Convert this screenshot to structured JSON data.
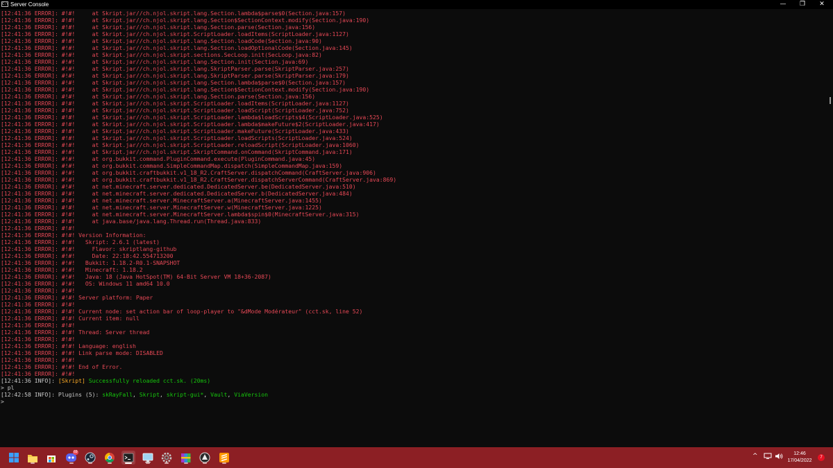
{
  "window": {
    "title": "Server Console",
    "icon_label": "C:\\",
    "minimize_glyph": "—",
    "maximize_glyph": "❐",
    "close_glyph": "✕"
  },
  "console": {
    "lines": [
      {
        "t": "[12:41:36 ERROR]: #!#!     at Skript.jar//ch.njol.skript.lang.Section.lambda$parse$0(Section.java:157)",
        "c": "err"
      },
      {
        "t": "[12:41:36 ERROR]: #!#!     at Skript.jar//ch.njol.skript.lang.Section$SectionContext.modify(Section.java:190)",
        "c": "err"
      },
      {
        "t": "[12:41:36 ERROR]: #!#!     at Skript.jar//ch.njol.skript.lang.Section.parse(Section.java:156)",
        "c": "err"
      },
      {
        "t": "[12:41:36 ERROR]: #!#!     at Skript.jar//ch.njol.skript.ScriptLoader.loadItems(ScriptLoader.java:1127)",
        "c": "err"
      },
      {
        "t": "[12:41:36 ERROR]: #!#!     at Skript.jar//ch.njol.skript.lang.Section.loadCode(Section.java:90)",
        "c": "err"
      },
      {
        "t": "[12:41:36 ERROR]: #!#!     at Skript.jar//ch.njol.skript.lang.Section.loadOptionalCode(Section.java:145)",
        "c": "err"
      },
      {
        "t": "[12:41:36 ERROR]: #!#!     at Skript.jar//ch.njol.skript.sections.SecLoop.init(SecLoop.java:82)",
        "c": "err"
      },
      {
        "t": "[12:41:36 ERROR]: #!#!     at Skript.jar//ch.njol.skript.lang.Section.init(Section.java:69)",
        "c": "err"
      },
      {
        "t": "[12:41:36 ERROR]: #!#!     at Skript.jar//ch.njol.skript.lang.SkriptParser.parse(SkriptParser.java:257)",
        "c": "err"
      },
      {
        "t": "[12:41:36 ERROR]: #!#!     at Skript.jar//ch.njol.skript.lang.SkriptParser.parse(SkriptParser.java:179)",
        "c": "err"
      },
      {
        "t": "[12:41:36 ERROR]: #!#!     at Skript.jar//ch.njol.skript.lang.Section.lambda$parse$0(Section.java:157)",
        "c": "err"
      },
      {
        "t": "[12:41:36 ERROR]: #!#!     at Skript.jar//ch.njol.skript.lang.Section$SectionContext.modify(Section.java:190)",
        "c": "err"
      },
      {
        "t": "[12:41:36 ERROR]: #!#!     at Skript.jar//ch.njol.skript.lang.Section.parse(Section.java:156)",
        "c": "err"
      },
      {
        "t": "[12:41:36 ERROR]: #!#!     at Skript.jar//ch.njol.skript.ScriptLoader.loadItems(ScriptLoader.java:1127)",
        "c": "err"
      },
      {
        "t": "[12:41:36 ERROR]: #!#!     at Skript.jar//ch.njol.skript.ScriptLoader.loadScript(ScriptLoader.java:752)",
        "c": "err"
      },
      {
        "t": "[12:41:36 ERROR]: #!#!     at Skript.jar//ch.njol.skript.ScriptLoader.lambda$loadScripts$4(ScriptLoader.java:525)",
        "c": "err"
      },
      {
        "t": "[12:41:36 ERROR]: #!#!     at Skript.jar//ch.njol.skript.ScriptLoader.lambda$makeFuture$2(ScriptLoader.java:417)",
        "c": "err"
      },
      {
        "t": "[12:41:36 ERROR]: #!#!     at Skript.jar//ch.njol.skript.ScriptLoader.makeFuture(ScriptLoader.java:433)",
        "c": "err"
      },
      {
        "t": "[12:41:36 ERROR]: #!#!     at Skript.jar//ch.njol.skript.ScriptLoader.loadScripts(ScriptLoader.java:524)",
        "c": "err"
      },
      {
        "t": "[12:41:36 ERROR]: #!#!     at Skript.jar//ch.njol.skript.ScriptLoader.reloadScript(ScriptLoader.java:1060)",
        "c": "err"
      },
      {
        "t": "[12:41:36 ERROR]: #!#!     at Skript.jar//ch.njol.skript.SkriptCommand.onCommand(SkriptCommand.java:171)",
        "c": "err"
      },
      {
        "t": "[12:41:36 ERROR]: #!#!     at org.bukkit.command.PluginCommand.execute(PluginCommand.java:45)",
        "c": "err"
      },
      {
        "t": "[12:41:36 ERROR]: #!#!     at org.bukkit.command.SimpleCommandMap.dispatch(SimpleCommandMap.java:159)",
        "c": "err"
      },
      {
        "t": "[12:41:36 ERROR]: #!#!     at org.bukkit.craftbukkit.v1_18_R2.CraftServer.dispatchCommand(CraftServer.java:906)",
        "c": "err"
      },
      {
        "t": "[12:41:36 ERROR]: #!#!     at org.bukkit.craftbukkit.v1_18_R2.CraftServer.dispatchServerCommand(CraftServer.java:869)",
        "c": "err"
      },
      {
        "t": "[12:41:36 ERROR]: #!#!     at net.minecraft.server.dedicated.DedicatedServer.be(DedicatedServer.java:510)",
        "c": "err"
      },
      {
        "t": "[12:41:36 ERROR]: #!#!     at net.minecraft.server.dedicated.DedicatedServer.b(DedicatedServer.java:484)",
        "c": "err"
      },
      {
        "t": "[12:41:36 ERROR]: #!#!     at net.minecraft.server.MinecraftServer.a(MinecraftServer.java:1455)",
        "c": "err"
      },
      {
        "t": "[12:41:36 ERROR]: #!#!     at net.minecraft.server.MinecraftServer.w(MinecraftServer.java:1225)",
        "c": "err"
      },
      {
        "t": "[12:41:36 ERROR]: #!#!     at net.minecraft.server.MinecraftServer.lambda$spin$0(MinecraftServer.java:315)",
        "c": "err"
      },
      {
        "t": "[12:41:36 ERROR]: #!#!     at java.base/java.lang.Thread.run(Thread.java:833)",
        "c": "err"
      },
      {
        "t": "[12:41:36 ERROR]: #!#!",
        "c": "err"
      },
      {
        "t": "[12:41:36 ERROR]: #!#! Version Information:",
        "c": "err"
      },
      {
        "t": "[12:41:36 ERROR]: #!#!   Skript: 2.6.1 (latest)",
        "c": "err"
      },
      {
        "t": "[12:41:36 ERROR]: #!#!     Flavor: skriptlang-github",
        "c": "err"
      },
      {
        "t": "[12:41:36 ERROR]: #!#!     Date: 22:18:42.554713200",
        "c": "err"
      },
      {
        "t": "[12:41:36 ERROR]: #!#!   Bukkit: 1.18.2-R0.1-SNAPSHOT",
        "c": "err"
      },
      {
        "t": "[12:41:36 ERROR]: #!#!   Minecraft: 1.18.2",
        "c": "err"
      },
      {
        "t": "[12:41:36 ERROR]: #!#!   Java: 18 (Java HotSpot(TM) 64-Bit Server VM 18+36-2087)",
        "c": "err"
      },
      {
        "t": "[12:41:36 ERROR]: #!#!   OS: Windows 11 amd64 10.0",
        "c": "err"
      },
      {
        "t": "[12:41:36 ERROR]: #!#!",
        "c": "err"
      },
      {
        "t": "[12:41:36 ERROR]: #!#! Server platform: Paper",
        "c": "err"
      },
      {
        "t": "[12:41:36 ERROR]: #!#!",
        "c": "err"
      },
      {
        "t": "[12:41:36 ERROR]: #!#! Current node: set action bar of loop-player to \"&dMode Modérateur\" (cct.sk, line 52)",
        "c": "err"
      },
      {
        "t": "[12:41:36 ERROR]: #!#! Current item: null",
        "c": "err"
      },
      {
        "t": "[12:41:36 ERROR]: #!#!",
        "c": "err"
      },
      {
        "t": "[12:41:36 ERROR]: #!#! Thread: Server thread",
        "c": "err"
      },
      {
        "t": "[12:41:36 ERROR]: #!#!",
        "c": "err"
      },
      {
        "t": "[12:41:36 ERROR]: #!#! Language: english",
        "c": "err"
      },
      {
        "t": "[12:41:36 ERROR]: #!#! Link parse mode: DISABLED",
        "c": "err"
      },
      {
        "t": "[12:41:36 ERROR]: #!#!",
        "c": "err"
      },
      {
        "t": "[12:41:36 ERROR]: #!#! End of Error.",
        "c": "err"
      },
      {
        "t": "[12:41:36 ERROR]: #!#!",
        "c": "err"
      }
    ],
    "reload_line": {
      "prefix": "[12:41:36 INFO]: ",
      "tag": "[Skript]",
      "message": " Successfully reloaded cct.sk. (20ms)"
    },
    "command_line": "> pl",
    "plugins_line": {
      "prefix": "[12:42:58 INFO]: Plugins (5): ",
      "plugins": [
        "skRayFall",
        "Skript",
        "skript-gui*",
        "Vault",
        "ViaVersion"
      ],
      "separator": ", "
    },
    "prompt": ">"
  },
  "taskbar": {
    "clock_time": "12:46",
    "clock_date": "17/04/2022",
    "discord_badge": "69",
    "tray_chevron": "^",
    "notification_badge": "7"
  },
  "colors": {
    "error_red": "#e74856",
    "info_gray": "#cccccc",
    "success_green": "#16c60c",
    "taskbar_red": "#8c1f24"
  }
}
